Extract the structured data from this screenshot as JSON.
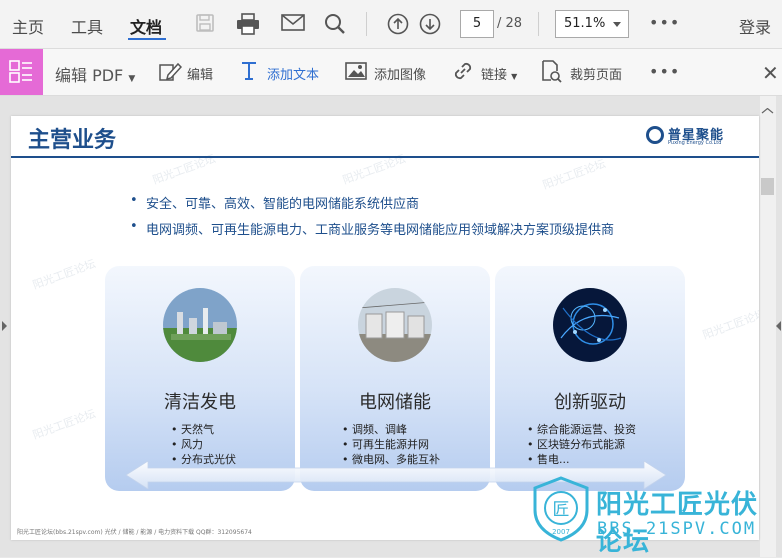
{
  "nav": {
    "home": "主页",
    "tools": "工具",
    "document": "文档",
    "login": "登录"
  },
  "pager": {
    "current": "5",
    "total": "/ 28"
  },
  "zoom": {
    "value": "51.1%"
  },
  "toolbar2": {
    "edit_pdf": "编辑 PDF",
    "edit": "编辑",
    "add_text": "添加文本",
    "add_image": "添加图像",
    "link": "链接",
    "crop": "裁剪页面"
  },
  "slide": {
    "title": "主营业务",
    "logo_text": "普星聚能",
    "logo_sub": "Puxing Energy Co.Ltd",
    "bullets": [
      "安全、可靠、高效、智能的电网储能系统供应商",
      "电网调频、可再生能源电力、工商业服务等电网储能应用领域解决方案顶级提供商"
    ],
    "cards": [
      {
        "title": "清洁发电",
        "items": [
          "天然气",
          "风力",
          "分布式光伏"
        ]
      },
      {
        "title": "电网储能",
        "items": [
          "调频、调峰",
          "可再生能源并网",
          "微电网、多能互补"
        ]
      },
      {
        "title": "创新驱动",
        "items": [
          "综合能源运营、投资",
          "区块链分布式能源",
          "售电..."
        ]
      }
    ],
    "footer": "阳光工匠论坛(bbs.21spv.com)      光伏 / 储能 / 能源 / 电力资料下载    QQ群：312095674"
  },
  "watermark": {
    "text": "阳光工匠光伏论坛",
    "url": "BBS.21SPV.COM",
    "badge_year": "2007",
    "badge_text": "匠"
  },
  "colors": {
    "accent": "#2f6fd1",
    "slide_blue": "#1e4f8c",
    "pink_tab": "#e56ad6",
    "watermark": "#38b4d8"
  }
}
